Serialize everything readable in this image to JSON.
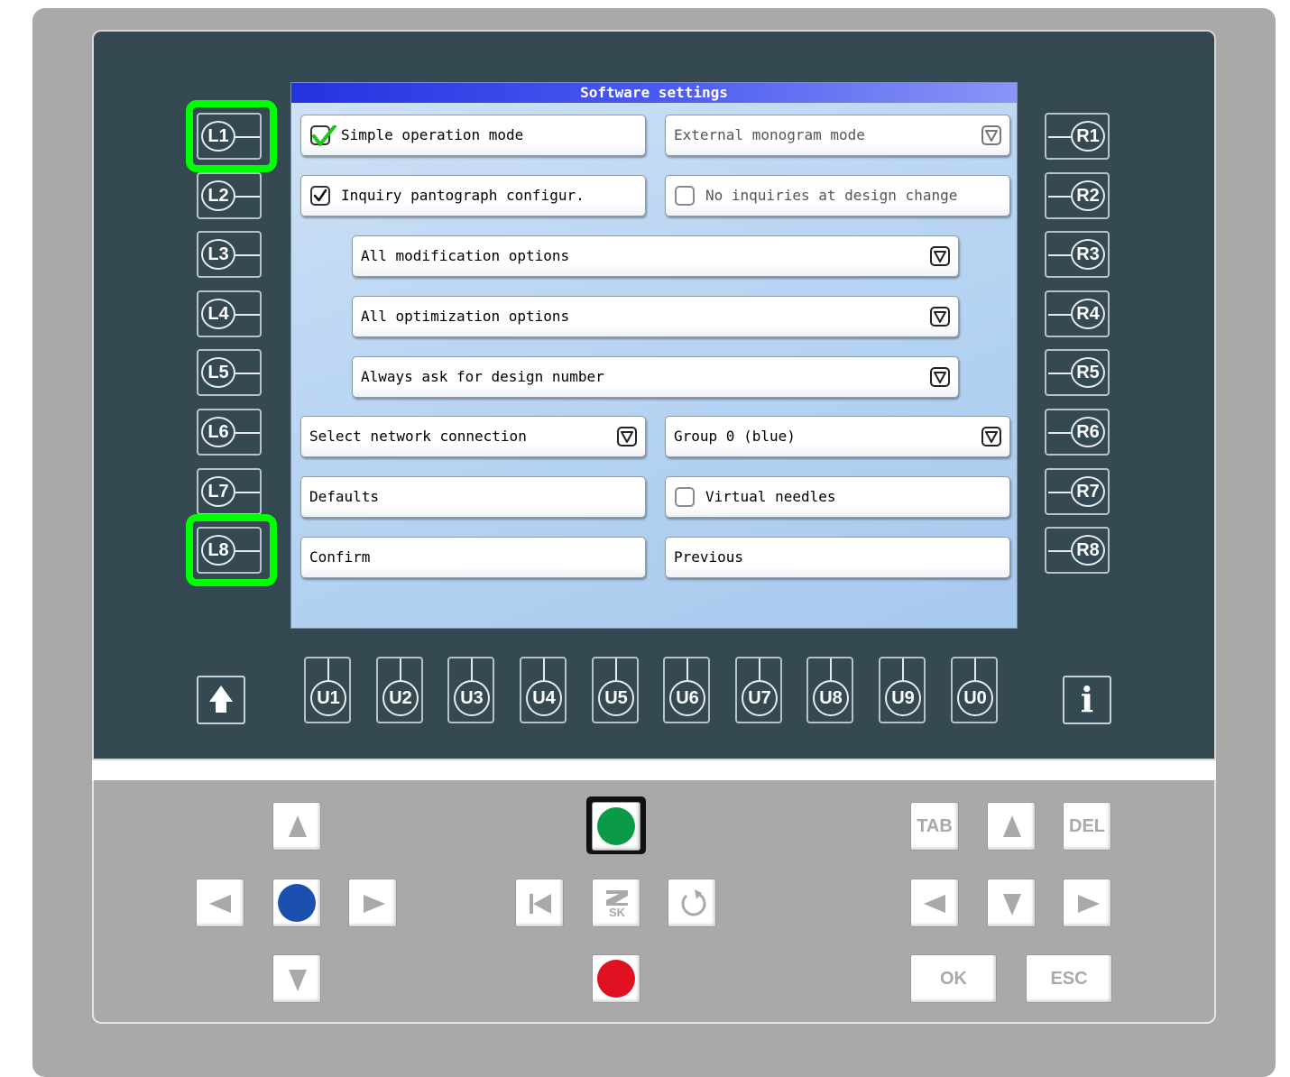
{
  "screen": {
    "title": "Software settings",
    "rows": {
      "simple_mode": "Simple operation mode",
      "external_monogram": "External monogram mode",
      "inquiry_pantograph": "Inquiry pantograph configur.",
      "no_inquiries": "No inquiries at design change",
      "modification": "All modification options",
      "optimization": "All optimization options",
      "design_number": "Always ask for design number",
      "network": "Select network connection",
      "group": "Group 0 (blue)",
      "defaults": "Defaults",
      "virtual_needles": "Virtual needles",
      "confirm": "Confirm",
      "previous": "Previous"
    },
    "checked": {
      "simple_mode": true,
      "inquiry_pantograph": true,
      "no_inquiries": false,
      "virtual_needles": false
    }
  },
  "left_keys": [
    "L1",
    "L2",
    "L3",
    "L4",
    "L5",
    "L6",
    "L7",
    "L8"
  ],
  "right_keys": [
    "R1",
    "R2",
    "R3",
    "R4",
    "R5",
    "R6",
    "R7",
    "R8"
  ],
  "bottom_keys": [
    "U1",
    "U2",
    "U3",
    "U4",
    "U5",
    "U6",
    "U7",
    "U8",
    "U9",
    "U0"
  ],
  "highlighted_keys": [
    "L1",
    "L8"
  ],
  "keypad": {
    "tab": "TAB",
    "del": "DEL",
    "ok": "OK",
    "esc": "ESC",
    "info": "i"
  },
  "colors": {
    "highlight": "#00ff00",
    "title_bar": "#2233e0",
    "start_button": "#0a9a4a",
    "stop_button": "#e01020",
    "blue_button": "#1c4fb0",
    "bezel": "#354952"
  }
}
